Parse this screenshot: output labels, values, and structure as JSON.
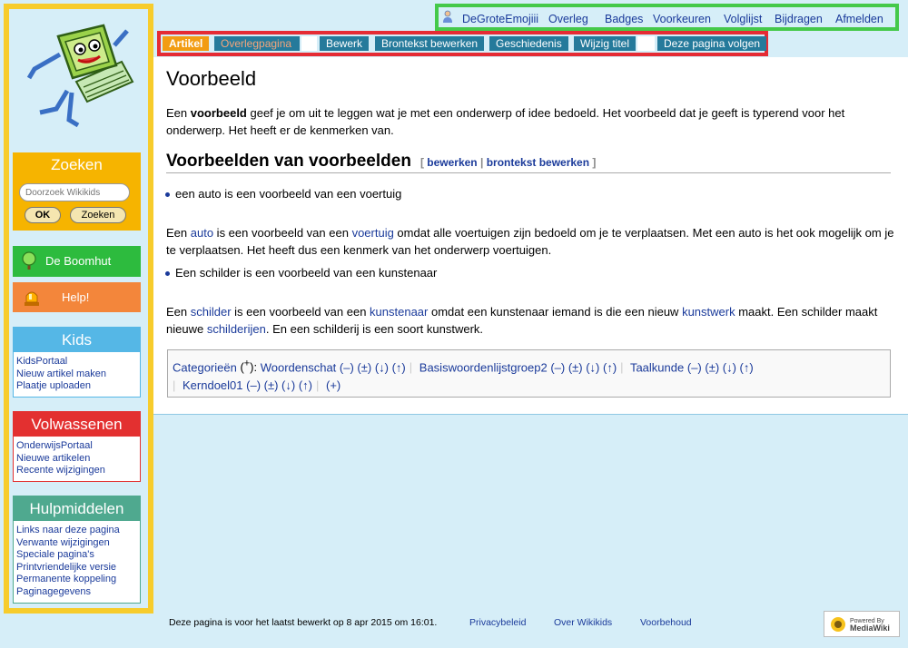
{
  "personal": {
    "items": [
      "DeGroteEmojiii",
      "Overleg",
      "Badges",
      "Voorkeuren",
      "Volglijst",
      "Bijdragen",
      "Afmelden"
    ]
  },
  "tabs": {
    "items": [
      "Artikel",
      "Overlegpagina",
      "Bewerk",
      "Brontekst bewerken",
      "Geschiedenis",
      "Wijzig titel",
      "Deze pagina volgen"
    ]
  },
  "sidebar": {
    "search": {
      "title": "Zoeken",
      "placeholder": "Doorzoek Wikikids",
      "ok": "OK",
      "go": "Zoeken"
    },
    "boomhut": "De Boomhut",
    "help": "Help!",
    "kids": {
      "title": "Kids",
      "links": [
        "KidsPortaal",
        "Nieuw artikel maken",
        "Plaatje uploaden"
      ]
    },
    "volwassenen": {
      "title": "Volwassenen",
      "links": [
        "OnderwijsPortaal",
        "Nieuwe artikelen",
        "Recente wijzigingen"
      ]
    },
    "hulpmiddelen": {
      "title": "Hulpmiddelen",
      "links": [
        "Links naar deze pagina",
        "Verwante wijzigingen",
        "Speciale pagina's",
        "Printvriendelijke versie",
        "Permanente koppeling",
        "Paginagegevens"
      ]
    }
  },
  "content": {
    "title": "Voorbeeld",
    "intro": {
      "pre": "Een ",
      "bold": "voorbeeld",
      "post": " geef je om uit te leggen wat je met een onderwerp of idee bedoeld. Het voorbeeld dat je geeft is typerend voor het onderwerp. Het heeft er de kenmerken van."
    },
    "section": {
      "title": "Voorbeelden van voorbeelden",
      "edit": "bewerken",
      "edit_source": "brontekst bewerken",
      "bracket_open": "[",
      "bracket_close": "]",
      "pipe": "|"
    },
    "bullet1": "een auto is een voorbeeld van een voertuig",
    "para2": {
      "t1": "Een ",
      "l1": "auto",
      "t2": " is een voorbeeld van een ",
      "l2": "voertuig",
      "t3": " omdat alle voertuigen zijn bedoeld om je te verplaatsen. Met een auto is het ook mogelijk om je te verplaatsen. Het heeft dus een kenmerk van het onderwerp voertuigen."
    },
    "bullet2": "Een schilder is een voorbeeld van een kunstenaar",
    "para3": {
      "t1": "Een ",
      "l1": "schilder",
      "t2": " is een voorbeeld van een ",
      "l2": "kunstenaar",
      "t3": " omdat een kunstenaar iemand is die een nieuw ",
      "l3": "kunstwerk",
      "t4": " maakt. Een schilder maakt nieuwe ",
      "l4": "schilderijen",
      "t5": ". En een schilderij is een soort kunstwerk."
    }
  },
  "categories": {
    "label": "Categorieën",
    "add": "(+",
    "add_sup": "+",
    "add_close": "):",
    "controls": "(–) (±) (↓) (↑)",
    "items": [
      "Woordenschat",
      "Basiswoordenlijstgroep2",
      "Taalkunde",
      "Kerndoel01"
    ],
    "plus": "(+)"
  },
  "footer": {
    "lastmod": "Deze pagina is voor het laatst bewerkt op 8 apr 2015 om 16:01.",
    "privacy": "Privacybeleid",
    "about": "Over Wikikids",
    "disclaimer": "Voorbehoud"
  },
  "badge": {
    "line1": "Powered By",
    "line2": "MediaWiki"
  },
  "icons": [
    "logo-robot",
    "user-icon",
    "tree-icon",
    "siren-icon",
    "mediawiki-sunflower"
  ]
}
